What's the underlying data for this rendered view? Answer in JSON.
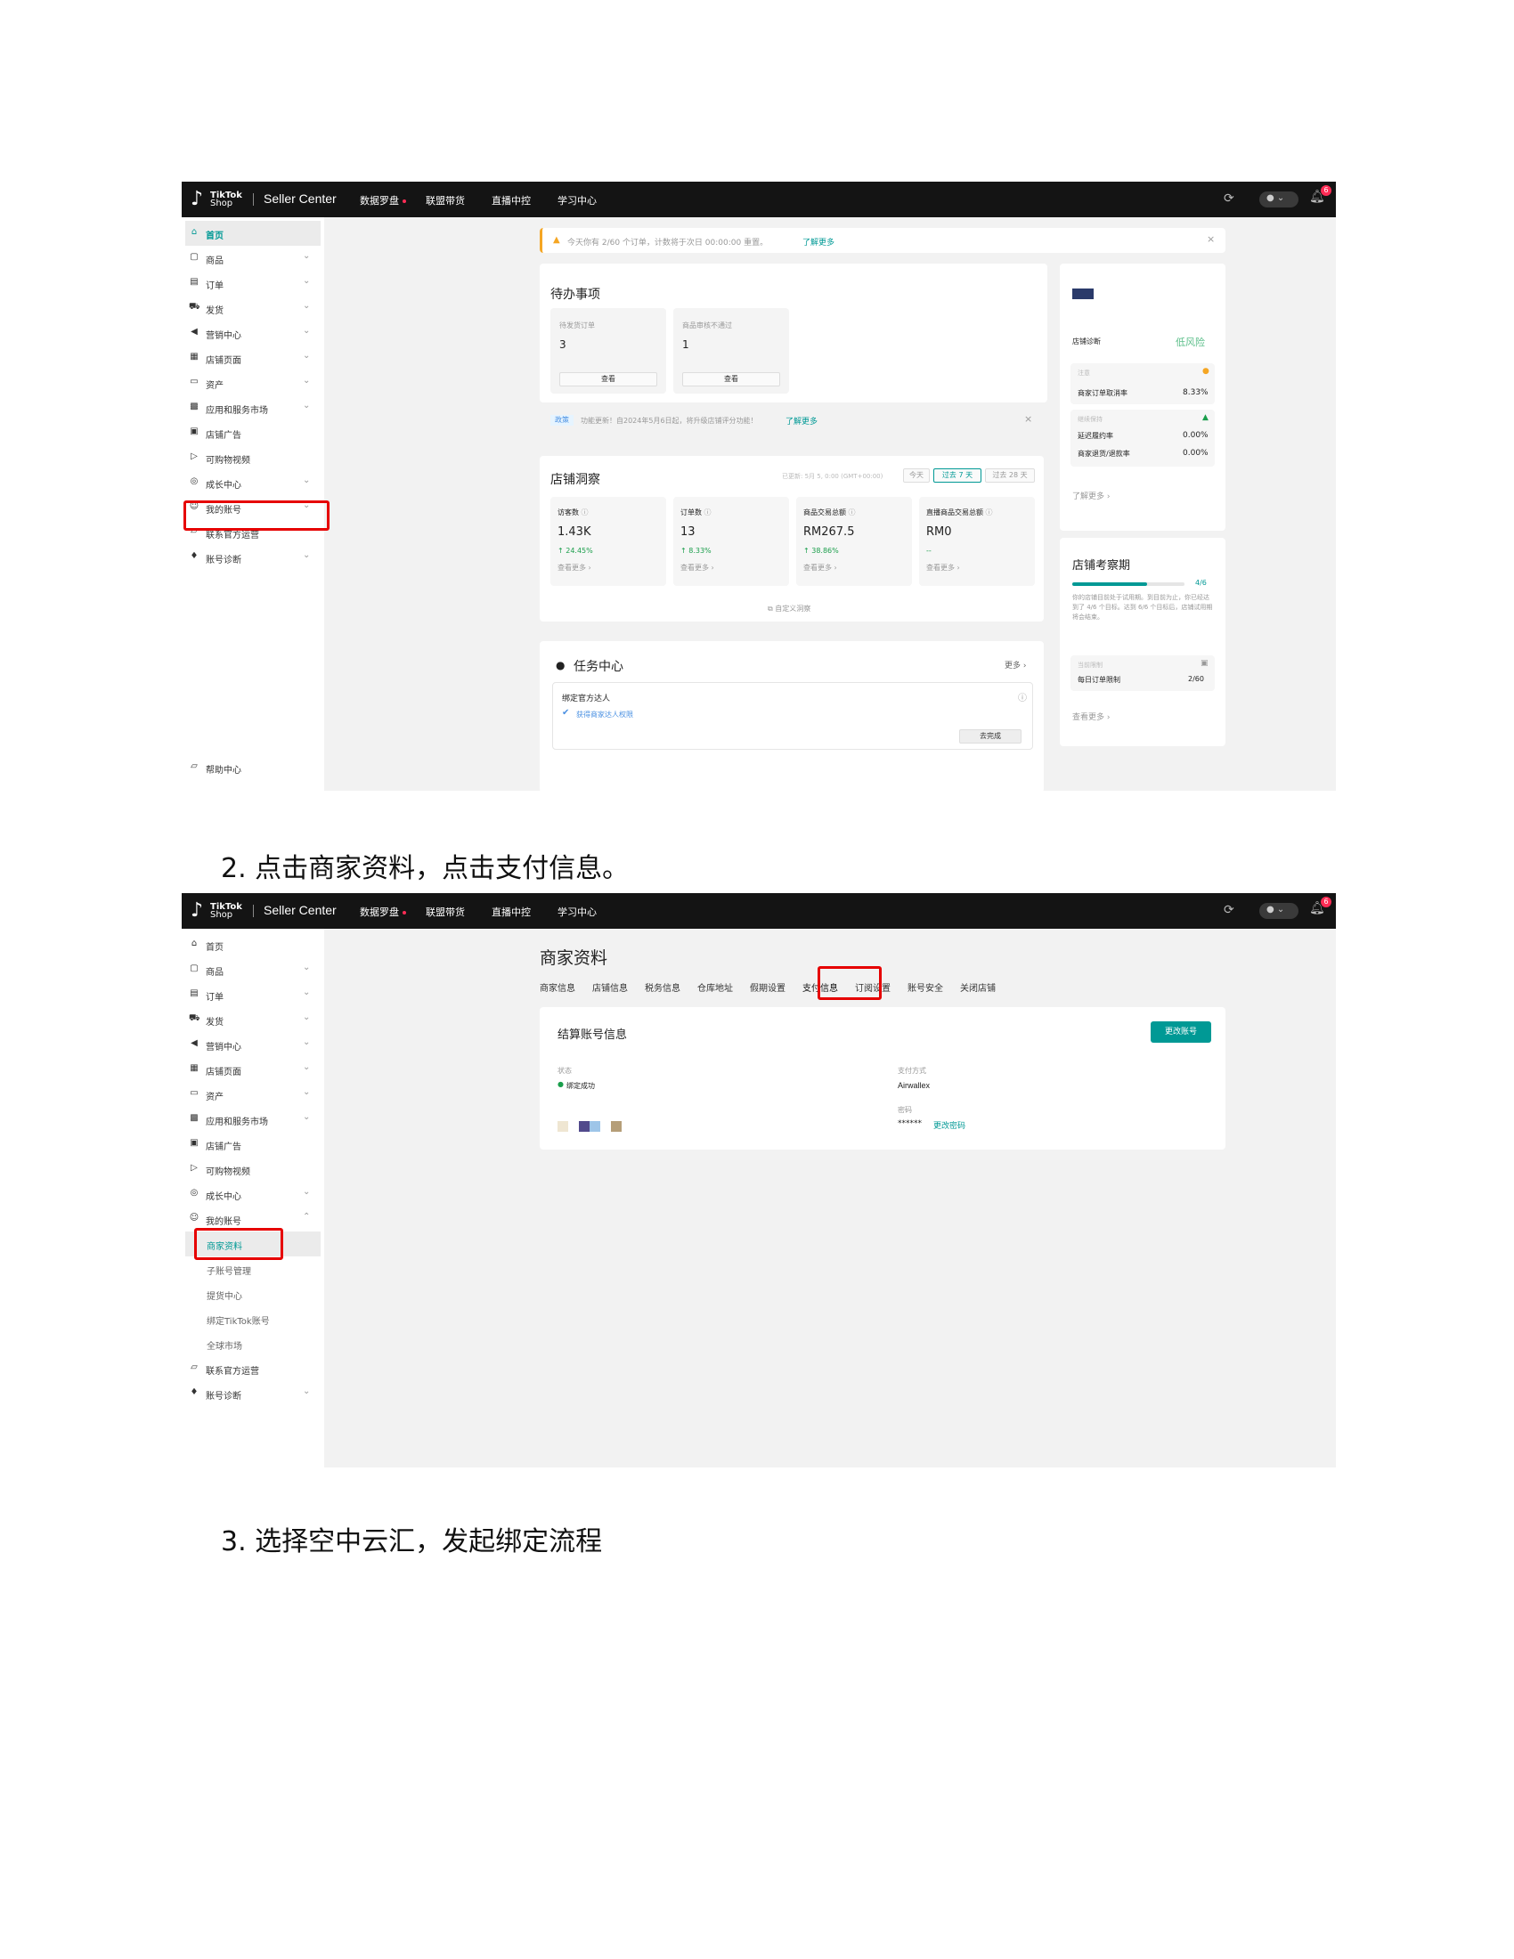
{
  "topbar": {
    "logo_tiktok": "TikTok",
    "logo_shop": "Shop",
    "brand": "Seller Center",
    "nav": [
      "数据罗盘",
      "联盟带货",
      "直播中控",
      "学习中心"
    ],
    "bell_count": "6"
  },
  "sidebar1": {
    "items": [
      {
        "label": "首页",
        "icon": "home-icon"
      },
      {
        "label": "商品",
        "icon": "box-icon"
      },
      {
        "label": "订单",
        "icon": "order-icon"
      },
      {
        "label": "发货",
        "icon": "truck-icon"
      },
      {
        "label": "营销中心",
        "icon": "megaphone-icon"
      },
      {
        "label": "店铺页面",
        "icon": "store-icon"
      },
      {
        "label": "资产",
        "icon": "wallet-icon"
      },
      {
        "label": "应用和服务市场",
        "icon": "apps-icon"
      },
      {
        "label": "店铺广告",
        "icon": "ad-icon"
      },
      {
        "label": "可购物视频",
        "icon": "video-icon"
      },
      {
        "label": "成长中心",
        "icon": "growth-icon"
      },
      {
        "label": "我的账号",
        "icon": "user-icon"
      },
      {
        "label": "联系官方运营",
        "icon": "chat-icon"
      },
      {
        "label": "账号诊断",
        "icon": "diagnosis-icon"
      }
    ],
    "help": "帮助中心"
  },
  "notice": {
    "text": "今天你有 2/60 个订单，计数将于次日 00:00:00 重置。",
    "link": "了解更多",
    "close": "×"
  },
  "todo": {
    "title": "待办事项",
    "cards": [
      {
        "label": "待发货订单",
        "value": "3",
        "button": "查看"
      },
      {
        "label": "商品审核不通过",
        "value": "1",
        "button": "查看"
      }
    ],
    "update_tag": "政策",
    "update_text": "功能更新！自2024年5月6日起，将升级店铺评分功能！",
    "update_link": "了解更多",
    "close": "×"
  },
  "insight": {
    "title": "店铺洞察",
    "updated": "已更新: 5月 5, 0:00 (GMT+00:00)",
    "ranges": [
      "今天",
      "过去 7 天",
      "过去 28 天"
    ],
    "metrics": [
      {
        "label": "访客数",
        "value": "1.43K",
        "change": "↑ 24.45%",
        "more": "查看更多 ›"
      },
      {
        "label": "订单数",
        "value": "13",
        "change": "↑ 8.33%",
        "more": "查看更多 ›"
      },
      {
        "label": "商品交易总额",
        "value": "RM267.5",
        "change": "↑ 38.86%",
        "more": "查看更多 ›"
      },
      {
        "label": "直播商品交易总额",
        "value": "RM0",
        "change": "--",
        "more": "查看更多 ›"
      }
    ],
    "customize": "自定义洞察"
  },
  "tasks": {
    "title": "任务中心",
    "more": "更多 ›",
    "task_title": "绑定官方达人",
    "task_tag": "获得商家达人权限",
    "button": "去完成"
  },
  "health": {
    "label": "店铺诊断",
    "risk": "低风险",
    "block1_tag": "注意",
    "block1_label": "商家订单取消率",
    "block1_value": "8.33%",
    "block2_tag": "继续保持",
    "block2_row1_label": "延迟履约率",
    "block2_row1_value": "0.00%",
    "block2_row2_label": "商家退货/退款率",
    "block2_row2_value": "0.00%",
    "more": "了解更多 ›"
  },
  "probation": {
    "title": "店铺考察期",
    "progress": 0.67,
    "progress_label": "4/6",
    "desc": "你的店铺目前处于试用期。到目前为止，你已经达到了 4/6 个目标。达到 6/6 个目标后，店铺试用期将会结束。",
    "limit_tag": "当前限制",
    "limit_label": "每日订单限制",
    "limit_value": "2/60",
    "more": "查看更多 ›"
  },
  "caption2": "2.  点击商家资料，点击支付信息。",
  "caption3": "3.  选择空中云汇，发起绑定流程",
  "sidebar2": {
    "items": [
      {
        "label": "首页",
        "icon": "home-icon"
      },
      {
        "label": "商品",
        "icon": "box-icon"
      },
      {
        "label": "订单",
        "icon": "order-icon"
      },
      {
        "label": "发货",
        "icon": "truck-icon"
      },
      {
        "label": "营销中心",
        "icon": "megaphone-icon"
      },
      {
        "label": "店铺页面",
        "icon": "store-icon"
      },
      {
        "label": "资产",
        "icon": "wallet-icon"
      },
      {
        "label": "应用和服务市场",
        "icon": "apps-icon"
      },
      {
        "label": "店铺广告",
        "icon": "ad-icon"
      },
      {
        "label": "可购物视频",
        "icon": "video-icon"
      },
      {
        "label": "成长中心",
        "icon": "growth-icon"
      },
      {
        "label": "我的账号",
        "icon": "user-icon"
      }
    ],
    "subitems": [
      "商家资料",
      "子账号管理",
      "提货中心",
      "绑定TikTok账号",
      "全球市场"
    ],
    "tail": [
      {
        "label": "联系官方运营",
        "icon": "chat-icon"
      },
      {
        "label": "账号诊断",
        "icon": "diagnosis-icon"
      }
    ]
  },
  "profile": {
    "title": "商家资料",
    "tabs": [
      "商家信息",
      "店铺信息",
      "税务信息",
      "仓库地址",
      "假期设置",
      "支付信息",
      "订阅设置",
      "账号安全",
      "关闭店铺"
    ],
    "active_tab": "支付信息",
    "card_title": "结算账号信息",
    "change_button": "更改账号",
    "status_label": "状态",
    "status_value": "绑定成功",
    "method_label": "支付方式",
    "method_value": "Airwallex",
    "password_label": "密码",
    "password_value": "******",
    "password_link": "更改密码"
  },
  "colors": {
    "accent": "#009995",
    "highlight_box": "#e60000",
    "topbar": "#141414"
  }
}
